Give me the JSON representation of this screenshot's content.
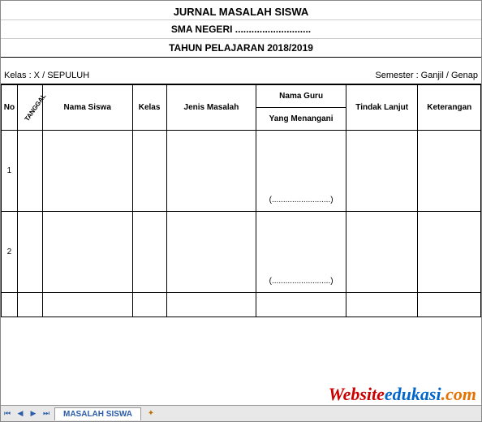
{
  "header": {
    "title": "JURNAL MASALAH SISWA",
    "school": "SMA NEGERI ............................",
    "year": "TAHUN PELAJARAN 2018/2019"
  },
  "info": {
    "kelas_label": "Kelas : X / SEPULUH",
    "semester_label": "Semester : Ganjil / Genap"
  },
  "columns": {
    "no": "No",
    "tanggal": "TANGGAL",
    "nama_siswa": "Nama Siswa",
    "kelas": "Kelas",
    "jenis_masalah": "Jenis Masalah",
    "nama_guru_top": "Nama Guru",
    "nama_guru_bottom": "Yang Menangani",
    "tindak_lanjut": "Tindak Lanjut",
    "keterangan": "Keterangan"
  },
  "rows": [
    {
      "no": "1",
      "guru_sign": "(..........................)"
    },
    {
      "no": "2",
      "guru_sign": "(..........................)"
    }
  ],
  "tabs": {
    "active": "MASALAH SISWA"
  },
  "watermark": {
    "p1": "Website",
    "p2": "edukasi",
    "p3": ".com"
  }
}
